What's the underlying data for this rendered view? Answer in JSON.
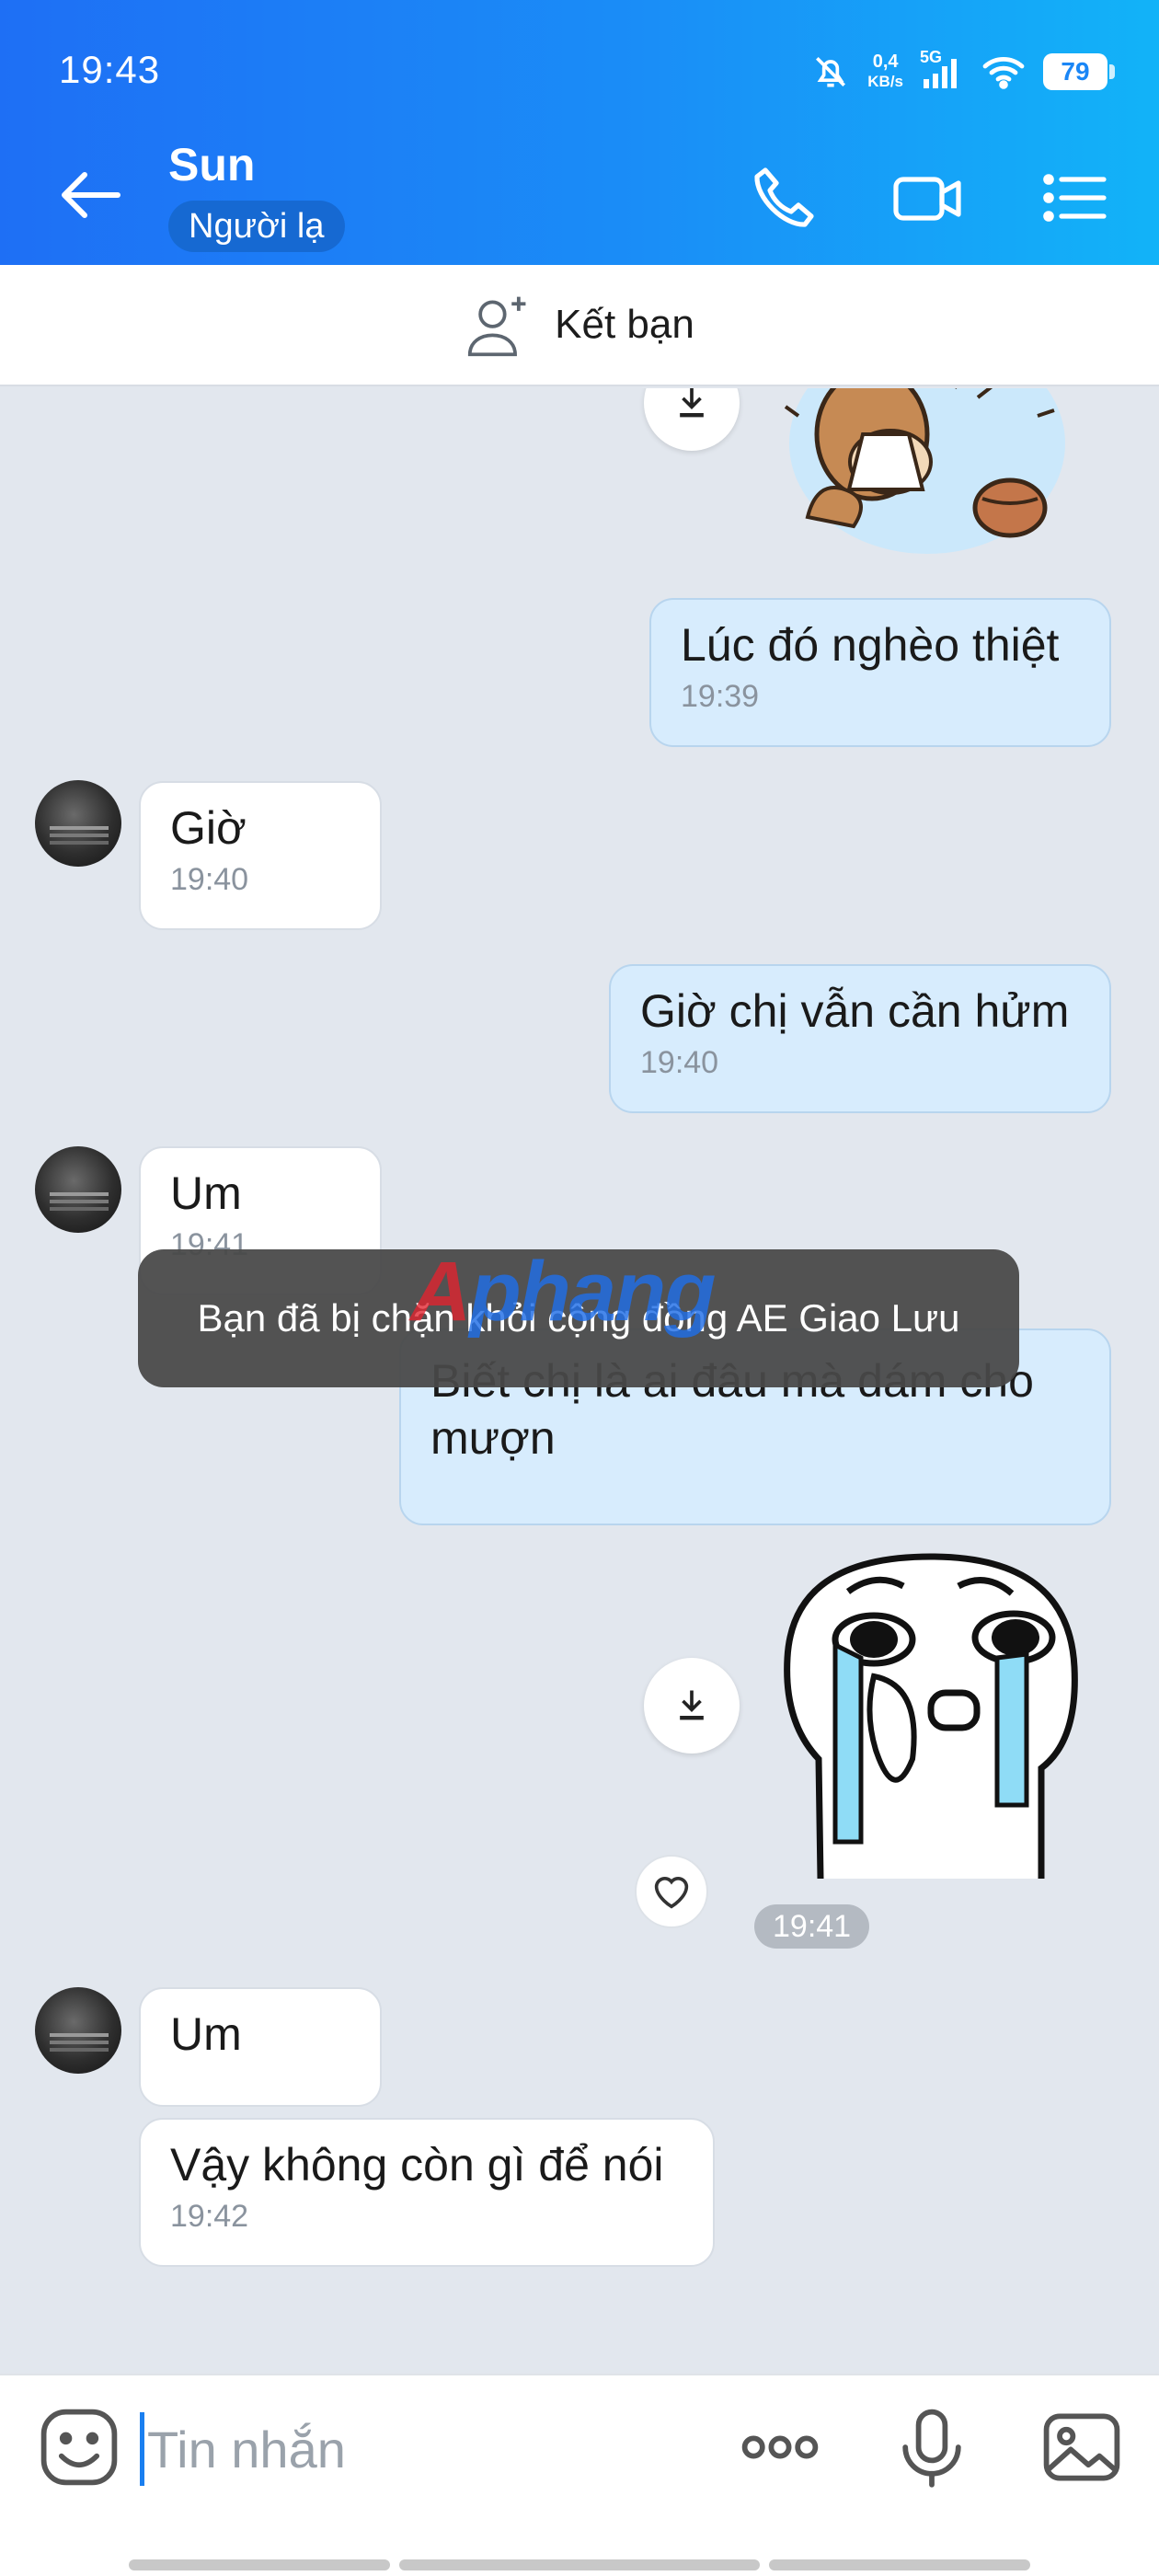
{
  "status_bar": {
    "time": "19:43",
    "net_speed_value": "0,4",
    "net_speed_unit": "KB/s",
    "network": "5G",
    "battery": "79"
  },
  "header": {
    "contact_name": "Sun",
    "contact_tag": "Người lạ"
  },
  "friend_bar": {
    "label": "Kết bạn"
  },
  "messages": [
    {
      "side": "mine",
      "text": "Lúc đó nghèo thiệt",
      "time": "19:39"
    },
    {
      "side": "theirs",
      "text": "Giờ",
      "time": "19:40"
    },
    {
      "side": "mine",
      "text": "Giờ chị vẫn cần hửm",
      "time": "19:40"
    },
    {
      "side": "theirs",
      "text": "Um",
      "time": "19:41"
    },
    {
      "side": "mine",
      "text_line1": "Biết chị là ai đâu mà dám cho",
      "text_line2": "mượn"
    },
    {
      "side": "theirs",
      "text": "Um"
    },
    {
      "side": "theirs",
      "text": "Vậy không còn gì để nói",
      "time": "19:42"
    }
  ],
  "sticker_time": "19:41",
  "toast": "Bạn đã bị chặn khỏi cộng đồng AE Giao Lưu",
  "watermark": {
    "part1": "A",
    "part2": "phang"
  },
  "input": {
    "placeholder": "Tin nhắn"
  },
  "colors": {
    "header_start": "#1e6ff5",
    "header_end": "#12b3f8",
    "chat_bg": "#e2e7ee",
    "my_bubble": "#d7ecfd"
  },
  "icons": [
    "back-arrow-icon",
    "phone-icon",
    "video-call-icon",
    "menu-list-icon",
    "add-friend-icon",
    "download-icon",
    "heart-icon",
    "emoji-icon",
    "more-icon",
    "microphone-icon",
    "image-icon"
  ]
}
